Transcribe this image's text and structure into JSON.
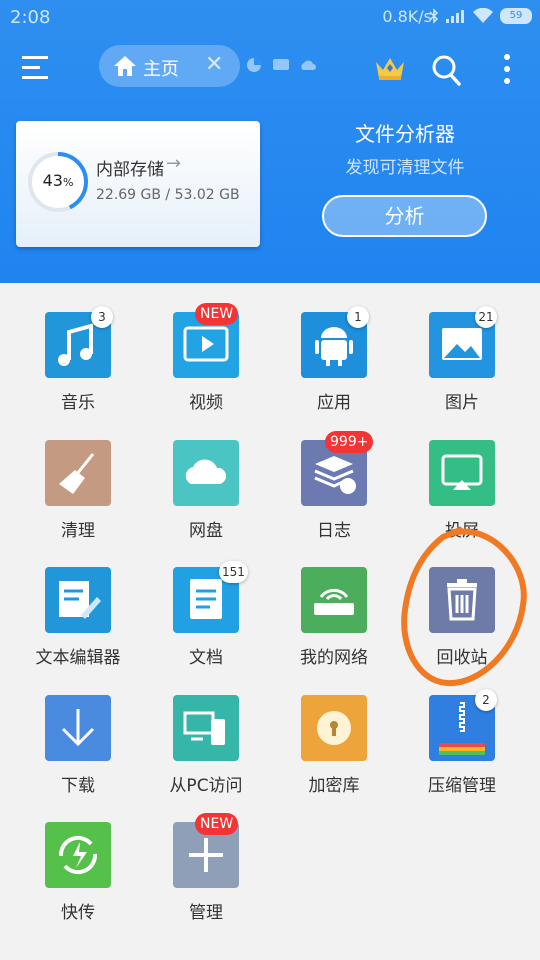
{
  "status_bar": {
    "time": "2:08",
    "speed": "0.8K/s",
    "battery": "59"
  },
  "appbar": {
    "tab_label": "主页",
    "menu_icon": "hamburger-icon",
    "vip_icon": "crown-icon",
    "search_icon": "search-icon",
    "more_icon": "more-vert-icon"
  },
  "storage": {
    "percent_label": "43",
    "percent_sign": "%",
    "percent_value": 43,
    "title": "内部存储",
    "arrow": "→",
    "size": "22.69 GB / 53.02 GB"
  },
  "analyzer": {
    "title": "文件分析器",
    "subtitle": "发现可清理文件",
    "button": "分析"
  },
  "tiles": [
    {
      "label": "音乐",
      "icon": "music-note-icon",
      "color": "#2196d9",
      "badge": "3"
    },
    {
      "label": "视频",
      "icon": "video-play-icon",
      "color": "#22a3e4",
      "badge": "NEW"
    },
    {
      "label": "应用",
      "icon": "android-icon",
      "color": "#1d8fdb",
      "badge": "1"
    },
    {
      "label": "图片",
      "icon": "image-icon",
      "color": "#2294e0",
      "badge": "21"
    },
    {
      "label": "清理",
      "icon": "broom-icon",
      "color": "#c49a83",
      "badge": ""
    },
    {
      "label": "网盘",
      "icon": "cloud-icon",
      "color": "#4bc4c4",
      "badge": ""
    },
    {
      "label": "日志",
      "icon": "log-stack-icon",
      "color": "#6b7bb2",
      "badge": "999+"
    },
    {
      "label": "投屏",
      "icon": "cast-screen-icon",
      "color": "#34bd84",
      "badge": ""
    },
    {
      "label": "文本编辑器",
      "icon": "text-edit-icon",
      "color": "#2196d9",
      "badge": ""
    },
    {
      "label": "文档",
      "icon": "document-icon",
      "color": "#22a0e4",
      "badge": "151"
    },
    {
      "label": "我的网络",
      "icon": "router-wifi-icon",
      "color": "#4cae5c",
      "badge": ""
    },
    {
      "label": "回收站",
      "icon": "trash-icon",
      "color": "#6e7aa8",
      "badge": ""
    },
    {
      "label": "下载",
      "icon": "download-arrow-icon",
      "color": "#4a8be0",
      "badge": ""
    },
    {
      "label": "从PC访问",
      "icon": "pc-transfer-icon",
      "color": "#36b6a8",
      "badge": ""
    },
    {
      "label": "加密库",
      "icon": "lock-safe-icon",
      "color": "#eda43a",
      "badge": ""
    },
    {
      "label": "压缩管理",
      "icon": "zip-icon",
      "color": "#2f7fe0",
      "badge": "2"
    },
    {
      "label": "快传",
      "icon": "quick-transfer-icon",
      "color": "#55c04a",
      "badge": ""
    },
    {
      "label": "管理",
      "icon": "plus-icon",
      "color": "#8f9fb8",
      "badge": "NEW"
    }
  ],
  "annotation_color": "#f07a23"
}
